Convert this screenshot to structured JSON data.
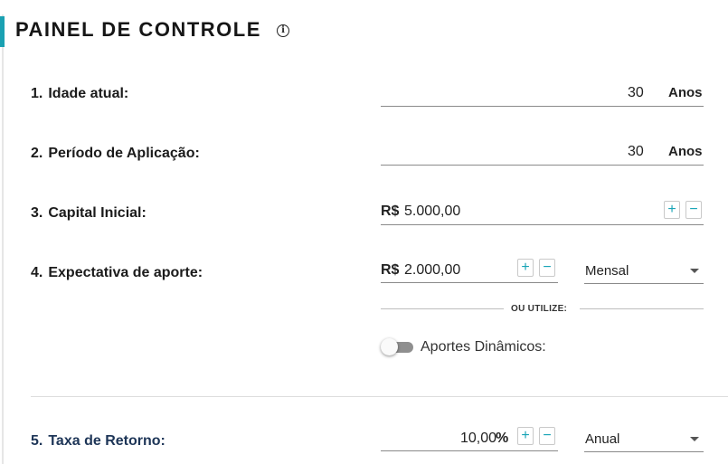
{
  "panel": {
    "title": "PAINEL DE CONTROLE",
    "info_icon": "info-icon"
  },
  "fields": {
    "age": {
      "number": "1.",
      "label": "Idade atual:",
      "value": "30",
      "unit": "Anos"
    },
    "period": {
      "number": "2.",
      "label": "Período de Aplicação:",
      "value": "30",
      "unit": "Anos"
    },
    "capital": {
      "number": "3.",
      "label": "Capital Inicial:",
      "prefix": "R$",
      "value": "5.000,00",
      "plus": "+",
      "minus": "−"
    },
    "contribution": {
      "number": "4.",
      "label": "Expectativa de aporte:",
      "prefix": "R$",
      "value": "2.000,00",
      "plus": "+",
      "minus": "−",
      "frequency": "Mensal"
    },
    "or_text": "OU UTILIZE:",
    "dynamic": {
      "label": "Aportes Dinâmicos:",
      "enabled": false
    },
    "rate": {
      "number": "5.",
      "label": "Taxa de Retorno:",
      "value": "10,00",
      "suffix": "%",
      "plus": "+",
      "minus": "−",
      "period": "Anual"
    }
  },
  "colors": {
    "accent": "#1aa1b2",
    "stepper_text": "#18a4b6",
    "rate_label": "#1d3557"
  }
}
